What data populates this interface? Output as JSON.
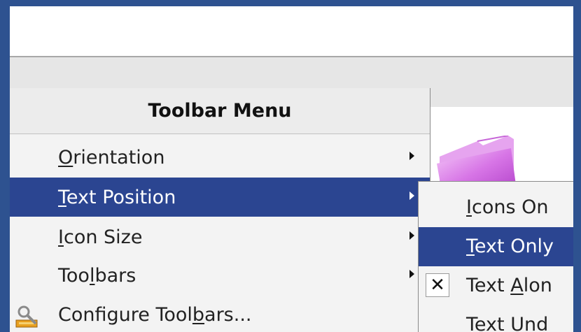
{
  "menu": {
    "title": "Toolbar Menu",
    "items": [
      {
        "pre": "",
        "mnemonic": "O",
        "post": "rientation",
        "submenu": true,
        "selected": false
      },
      {
        "pre": "",
        "mnemonic": "T",
        "post": "ext Position",
        "submenu": true,
        "selected": true
      },
      {
        "pre": "",
        "mnemonic": "I",
        "post": "con Size",
        "submenu": true,
        "selected": false
      },
      {
        "pre": "Too",
        "mnemonic": "l",
        "post": "bars",
        "submenu": true,
        "selected": false
      },
      {
        "pre": "Configure Tool",
        "mnemonic": "b",
        "post": "ars...",
        "submenu": false,
        "icon": "configure-toolbars-icon",
        "selected": false
      }
    ]
  },
  "submenu": {
    "items": [
      {
        "pre": "",
        "mnemonic": "I",
        "post": "cons On",
        "checked": false,
        "selected": false
      },
      {
        "pre": "",
        "mnemonic": "T",
        "post": "ext Only",
        "checked": false,
        "selected": true
      },
      {
        "pre": "Text ",
        "mnemonic": "A",
        "post": "lon",
        "checked": true,
        "selected": false
      },
      {
        "pre": "Text ",
        "mnemonic": "U",
        "post": "nd",
        "checked": false,
        "selected": false
      }
    ],
    "check_glyph": "✕"
  },
  "colors": {
    "selection": "#2b4591",
    "frame_border": "#2e5290",
    "folder": "#cc66dd"
  }
}
